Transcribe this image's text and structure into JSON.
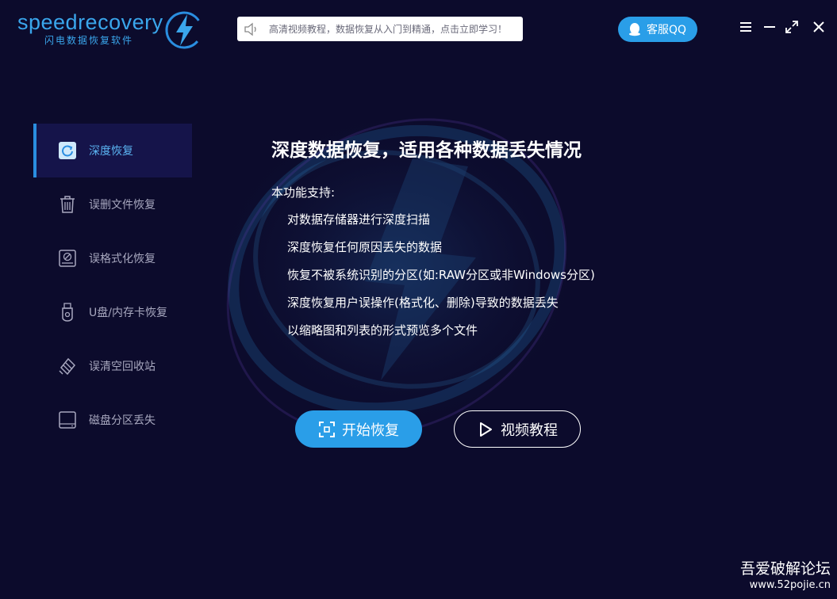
{
  "app": {
    "logo_text": "speedrecovery",
    "logo_subtitle": "闪电数据恢复软件"
  },
  "notice": {
    "text": "高清视频教程，数据恢复从入门到精通，点击立即学习！"
  },
  "header": {
    "qq_label": "客服QQ"
  },
  "sidebar": {
    "items": [
      {
        "label": "深度恢复",
        "icon": "deep-recovery-icon",
        "active": true
      },
      {
        "label": "误删文件恢复",
        "icon": "trash-icon",
        "active": false
      },
      {
        "label": "误格式化恢复",
        "icon": "format-drive-icon",
        "active": false
      },
      {
        "label": "U盘/内存卡恢复",
        "icon": "usb-drive-icon",
        "active": false
      },
      {
        "label": "误清空回收站",
        "icon": "recycle-bin-icon",
        "active": false
      },
      {
        "label": "磁盘分区丢失",
        "icon": "disk-partition-icon",
        "active": false
      }
    ]
  },
  "main": {
    "title": "深度数据恢复，适用各种数据丢失情况",
    "support_heading": "本功能支持:",
    "features": [
      "对数据存储器进行深度扫描",
      "深度恢复任何原因丢失的数据",
      "恢复不被系统识别的分区(如:RAW分区或非Windows分区)",
      "深度恢复用户误操作(格式化、删除)导致的数据丢失",
      "以缩略图和列表的形式预览多个文件"
    ],
    "start_button": "开始恢复",
    "video_button": "视频教程"
  },
  "watermark": {
    "line1": "吾爱破解论坛",
    "line2": "www.52pojie.cn"
  },
  "colors": {
    "background": "#0c0b2c",
    "accent": "#2a9ee8",
    "active_item_bg": "#15144a",
    "active_text": "#5bb4f2",
    "inactive_text": "#a8a8bf"
  }
}
